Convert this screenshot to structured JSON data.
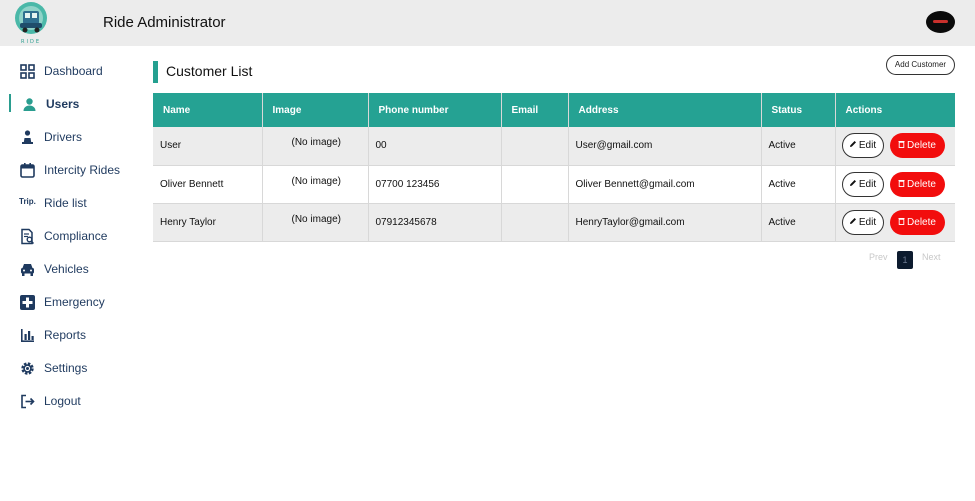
{
  "header": {
    "app_title": "Ride Administrator",
    "logo_icon": "ride-logo-icon",
    "avatar_icon": "user-avatar-icon"
  },
  "sidebar": {
    "items": [
      {
        "label": "Dashboard",
        "icon": "grid-icon"
      },
      {
        "label": "Users",
        "icon": "user-icon",
        "active": true
      },
      {
        "label": "Drivers",
        "icon": "driver-icon"
      },
      {
        "label": "Intercity Rides",
        "icon": "calendar-icon"
      },
      {
        "label": "Ride list",
        "icon": "trip-text-icon",
        "icon_text": "Trip."
      },
      {
        "label": "Compliance",
        "icon": "document-search-icon"
      },
      {
        "label": "Vehicles",
        "icon": "car-icon"
      },
      {
        "label": "Emergency",
        "icon": "medical-cross-icon"
      },
      {
        "label": "Reports",
        "icon": "bar-chart-icon"
      },
      {
        "label": "Settings",
        "icon": "gear-icon"
      },
      {
        "label": "Logout",
        "icon": "logout-icon"
      }
    ]
  },
  "main": {
    "title": "Customer List",
    "add_button": "Add Customer",
    "table": {
      "columns": [
        "Name",
        "Image",
        "Phone number",
        "Email",
        "Address",
        "Status",
        "Actions"
      ],
      "rows": [
        {
          "name": "User",
          "image": "(No image)",
          "phone": "00",
          "email": "",
          "address": "User@gmail.com",
          "status": "Active"
        },
        {
          "name": "Oliver Bennett",
          "image": "(No image)",
          "phone": "07700 123456",
          "email": "",
          "address": "Oliver Bennett@gmail.com",
          "status": "Active"
        },
        {
          "name": "Henry Taylor",
          "image": "(No image)",
          "phone": "07912345678",
          "email": "",
          "address": "HenryTaylor@gmail.com",
          "status": "Active"
        }
      ],
      "edit_label": "Edit",
      "delete_label": "Delete"
    },
    "pagination": {
      "prev": "Prev",
      "page": "1",
      "next": "Next"
    }
  },
  "colors": {
    "accent": "#25a293",
    "delete": "#f20d0d",
    "header_bg": "#ececec",
    "nav_text": "#1f3a5f"
  }
}
